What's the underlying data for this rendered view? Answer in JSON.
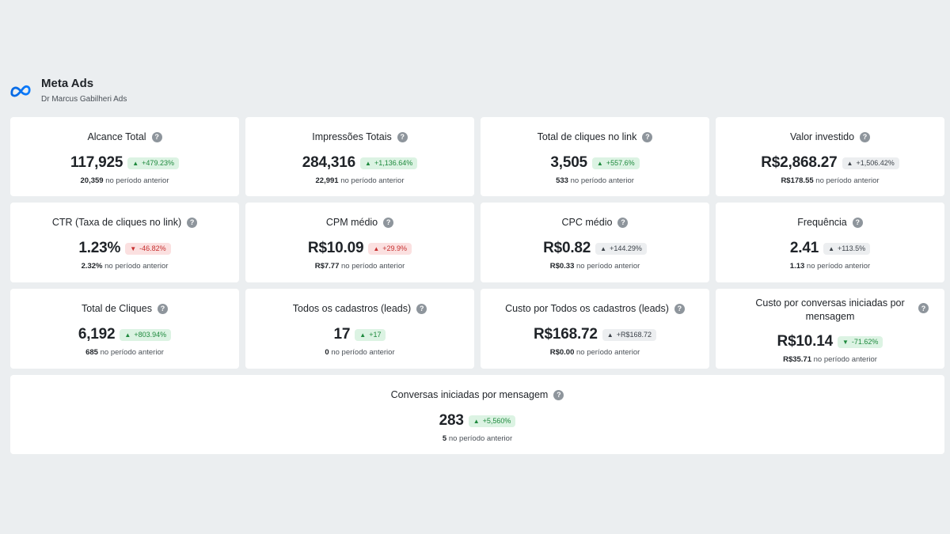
{
  "header": {
    "title": "Meta Ads",
    "subtitle": "Dr Marcus Gabilheri Ads"
  },
  "prev_suffix": "no período anterior",
  "cards": [
    {
      "title": "Alcance Total",
      "value": "117,925",
      "change": "+479.23%",
      "trend": "up",
      "previous": "20,359"
    },
    {
      "title": "Impressões Totais",
      "value": "284,316",
      "change": "+1,136.64%",
      "trend": "up",
      "previous": "22,991"
    },
    {
      "title": "Total de cliques no link",
      "value": "3,505",
      "change": "+557.6%",
      "trend": "up",
      "previous": "533"
    },
    {
      "title": "Valor investido",
      "value": "R$2,868.27",
      "change": "+1,506.42%",
      "trend": "neutral",
      "previous": "R$178.55"
    },
    {
      "title": "CTR (Taxa de cliques no link)",
      "value": "1.23%",
      "change": "-46.82%",
      "trend": "down",
      "previous": "2.32%"
    },
    {
      "title": "CPM médio",
      "value": "R$10.09",
      "change": "+29.9%",
      "trend": "down-up",
      "previous": "R$7.77"
    },
    {
      "title": "CPC médio",
      "value": "R$0.82",
      "change": "+144.29%",
      "trend": "neutral",
      "previous": "R$0.33"
    },
    {
      "title": "Frequência",
      "value": "2.41",
      "change": "+113.5%",
      "trend": "neutral",
      "previous": "1.13"
    },
    {
      "title": "Total de Cliques",
      "value": "6,192",
      "change": "+803.94%",
      "trend": "up",
      "previous": "685"
    },
    {
      "title": "Todos os cadastros (leads)",
      "value": "17",
      "change": "+17",
      "trend": "up",
      "previous": "0"
    },
    {
      "title": "Custo por Todos os cadastros (leads)",
      "value": "R$168.72",
      "change": "+R$168.72",
      "trend": "neutral",
      "previous": "R$0.00"
    },
    {
      "title": "Custo por conversas iniciadas por mensagem",
      "value": "R$10.14",
      "change": "-71.62%",
      "trend": "downgood",
      "previous": "R$35.71"
    },
    {
      "title": "Conversas iniciadas por mensagem",
      "value": "283",
      "change": "+5,560%",
      "trend": "up",
      "previous": "5"
    }
  ],
  "colors": {
    "background": "#ebeef0",
    "up": "#1f8a3e",
    "down": "#c62f2f",
    "neutral": "#3d434a",
    "brand": "#0866ff"
  },
  "icons": {
    "logo": "meta-infinity-logo",
    "help": "question-circle-icon"
  }
}
